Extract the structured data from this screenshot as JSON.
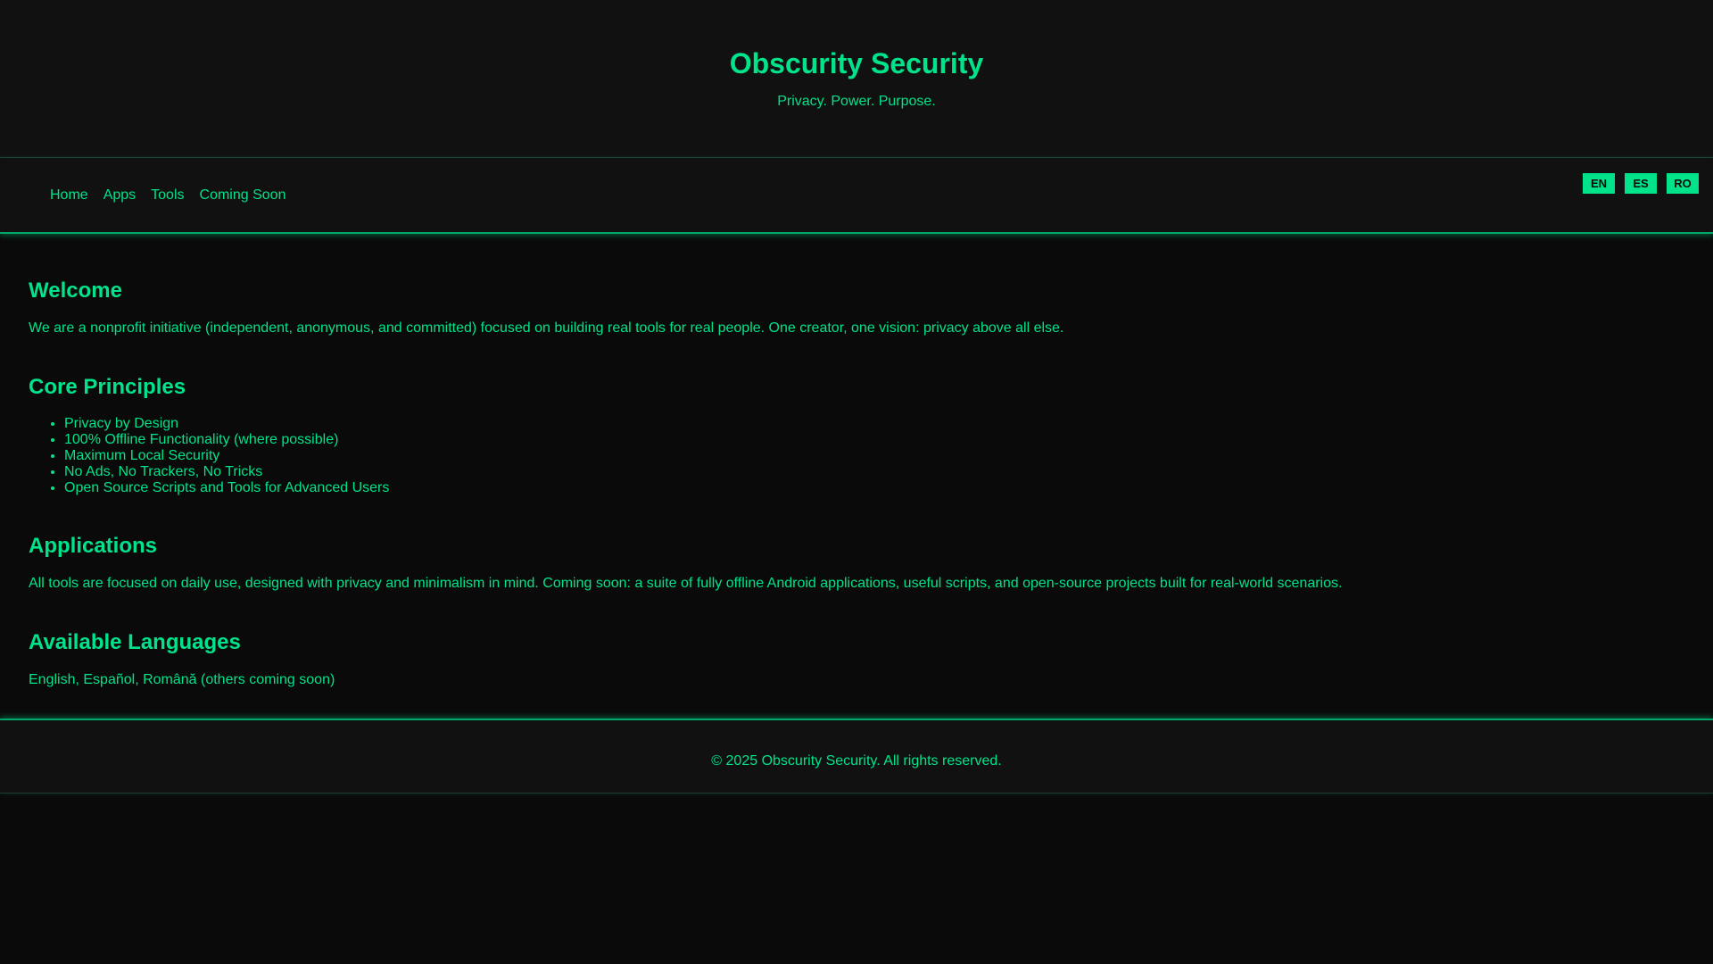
{
  "colors": {
    "accent": "#00e38a",
    "background": "#0a0a0a",
    "panel": "#111111"
  },
  "header": {
    "title": "Obscurity Security",
    "tagline": "Privacy. Power. Purpose."
  },
  "nav": {
    "links": [
      {
        "label": "Home"
      },
      {
        "label": "Apps"
      },
      {
        "label": "Tools"
      },
      {
        "label": "Coming Soon"
      }
    ],
    "languages": [
      {
        "label": "EN"
      },
      {
        "label": "ES"
      },
      {
        "label": "RO"
      }
    ]
  },
  "main": {
    "welcome": {
      "heading": "Welcome",
      "text": "We are a nonprofit initiative (independent, anonymous, and committed) focused on building real tools for real people. One creator, one vision: privacy above all else."
    },
    "principles": {
      "heading": "Core Principles",
      "items": [
        "Privacy by Design",
        "100% Offline Functionality (where possible)",
        "Maximum Local Security",
        "No Ads, No Trackers, No Tricks",
        "Open Source Scripts and Tools for Advanced Users"
      ]
    },
    "applications": {
      "heading": "Applications",
      "text": "All tools are focused on daily use, designed with privacy and minimalism in mind. Coming soon: a suite of fully offline Android applications, useful scripts, and open-source projects built for real-world scenarios."
    },
    "languages": {
      "heading": "Available Languages",
      "text": "English, Español, Română (others coming soon)"
    }
  },
  "footer": {
    "text": "© 2025 Obscurity Security. All rights reserved."
  }
}
